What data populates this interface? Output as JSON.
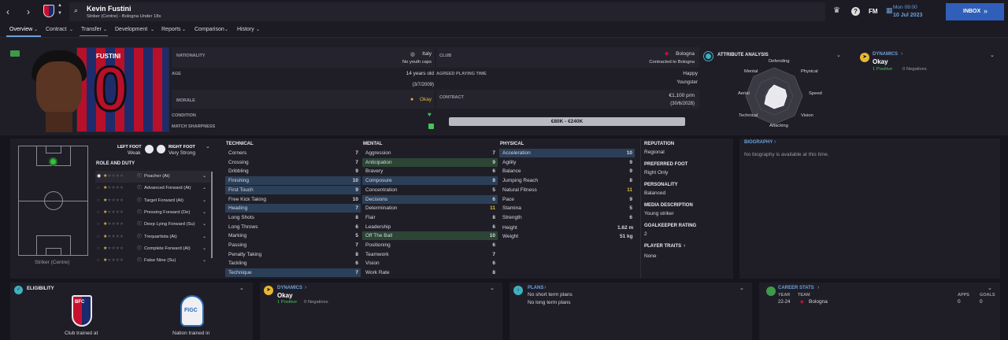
{
  "header": {
    "player_name": "Kevin Fustini",
    "subtitle": "Striker (Centre) - Bologna Under 18s",
    "date_day": "Mon 09:00",
    "date": "10 Jul 2023",
    "inbox_label": "INBOX",
    "fm_label": "FM",
    "help_label": "?"
  },
  "nav": [
    "Overview",
    "Contract",
    "Transfer",
    "Development",
    "Reports",
    "Comparison",
    "History"
  ],
  "card": {
    "shirt_name": "FUSTINI",
    "shirt_number": "0"
  },
  "info": {
    "nationality_label": "NATIONALITY",
    "nationality": "Italy",
    "youth_caps": "No youth caps",
    "age_label": "AGE",
    "age": "14 years old",
    "dob": "(3/7/2009)",
    "morale_label": "MORALE",
    "morale": "Okay",
    "condition_label": "CONDITION",
    "sharpness_label": "MATCH SHARPNESS",
    "club_label": "CLUB",
    "club": "Bologna",
    "club_contract": "Contracted to Bologna",
    "playing_time_label": "AGREED PLAYING TIME",
    "playing_time": "Happy",
    "playing_status": "Youngster",
    "contract_label": "CONTRACT",
    "wage": "€1,100 p/m",
    "contract_end": "(30/6/2028)",
    "value_range": "€80K - €240K"
  },
  "attr_analysis": {
    "title": "ATTRIBUTE ANALYSIS",
    "labels": [
      "Defending",
      "Physical",
      "Speed",
      "Vision",
      "Attacking",
      "Technical",
      "Aerial",
      "Mental"
    ]
  },
  "dynamics": {
    "title": "DYNAMICS",
    "status": "Okay",
    "positive": "1 Positive",
    "negatives": "0 Negatives"
  },
  "feet": {
    "left_label": "LEFT FOOT",
    "left": "Weak",
    "right_label": "RIGHT FOOT",
    "right": "Very Strong"
  },
  "role": {
    "title": "ROLE AND DUTY",
    "position_caption": "Striker (Centre)",
    "roles": [
      "Poacher (At)",
      "Advanced Forward (At)",
      "Target Forward (At)",
      "Pressing Forward (De)",
      "Deep Lying Forward (Su)",
      "Trequartista (At)",
      "Complete Forward (At)",
      "False Nine (Su)"
    ]
  },
  "technical": {
    "title": "TECHNICAL",
    "items": [
      {
        "name": "Corners",
        "value": "7"
      },
      {
        "name": "Crossing",
        "value": "7"
      },
      {
        "name": "Dribbling",
        "value": "9"
      },
      {
        "name": "Finishing",
        "value": "10"
      },
      {
        "name": "First Touch",
        "value": "9"
      },
      {
        "name": "Free Kick Taking",
        "value": "10"
      },
      {
        "name": "Heading",
        "value": "7"
      },
      {
        "name": "Long Shots",
        "value": "8"
      },
      {
        "name": "Long Throws",
        "value": "6"
      },
      {
        "name": "Marking",
        "value": "5"
      },
      {
        "name": "Passing",
        "value": "7"
      },
      {
        "name": "Penalty Taking",
        "value": "8"
      },
      {
        "name": "Tackling",
        "value": "6"
      },
      {
        "name": "Technique",
        "value": "7"
      }
    ]
  },
  "mental": {
    "title": "MENTAL",
    "items": [
      {
        "name": "Aggression",
        "value": "7"
      },
      {
        "name": "Anticipation",
        "value": "9"
      },
      {
        "name": "Bravery",
        "value": "6"
      },
      {
        "name": "Composure",
        "value": "8"
      },
      {
        "name": "Concentration",
        "value": "5"
      },
      {
        "name": "Decisions",
        "value": "6"
      },
      {
        "name": "Determination",
        "value": "11"
      },
      {
        "name": "Flair",
        "value": "8"
      },
      {
        "name": "Leadership",
        "value": "6"
      },
      {
        "name": "Off The Ball",
        "value": "10"
      },
      {
        "name": "Positioning",
        "value": "6"
      },
      {
        "name": "Teamwork",
        "value": "7"
      },
      {
        "name": "Vision",
        "value": "6"
      },
      {
        "name": "Work Rate",
        "value": "8"
      }
    ]
  },
  "physical": {
    "title": "PHYSICAL",
    "items": [
      {
        "name": "Acceleration",
        "value": "10"
      },
      {
        "name": "Agility",
        "value": "9"
      },
      {
        "name": "Balance",
        "value": "9"
      },
      {
        "name": "Jumping Reach",
        "value": "8"
      },
      {
        "name": "Natural Fitness",
        "value": "11"
      },
      {
        "name": "Pace",
        "value": "9"
      },
      {
        "name": "Stamina",
        "value": "5"
      },
      {
        "name": "Strength",
        "value": "6"
      }
    ],
    "height_label": "Height",
    "height": "1.62 m",
    "weight_label": "Weight",
    "weight": "51 kg"
  },
  "profile": {
    "reputation_label": "REPUTATION",
    "reputation": "Regional",
    "pref_foot_label": "PREFERRED FOOT",
    "pref_foot": "Right Only",
    "personality_label": "PERSONALITY",
    "personality": "Balanced",
    "media_label": "MEDIA DESCRIPTION",
    "media": "Young striker",
    "gk_label": "GOALKEEPER RATING",
    "gk": "2",
    "traits_label": "PLAYER TRAITS",
    "traits": "None"
  },
  "biography": {
    "title": "BIOGRAPHY",
    "text": "No biography is available at this time."
  },
  "eligibility": {
    "title": "ELIGIBILITY",
    "club_trained": "Club trained at",
    "nation_trained": "Nation trained in",
    "club_badge": "BFC",
    "nation_badge": "FIGC"
  },
  "plans": {
    "title": "PLANS",
    "short": "No short term plans",
    "long": "No long term plans"
  },
  "career": {
    "title": "CAREER STATS",
    "year_h": "YEAR",
    "team_h": "TEAM",
    "apps_h": "APPS",
    "goals_h": "GOALS",
    "year": "22-24",
    "team": "Bologna",
    "apps": "0",
    "goals": "0"
  },
  "colors": {
    "accent": "#6aa0d8",
    "inbox": "#2f5fb8",
    "highlight": "#2c3f58",
    "good": "#d8c23a"
  }
}
